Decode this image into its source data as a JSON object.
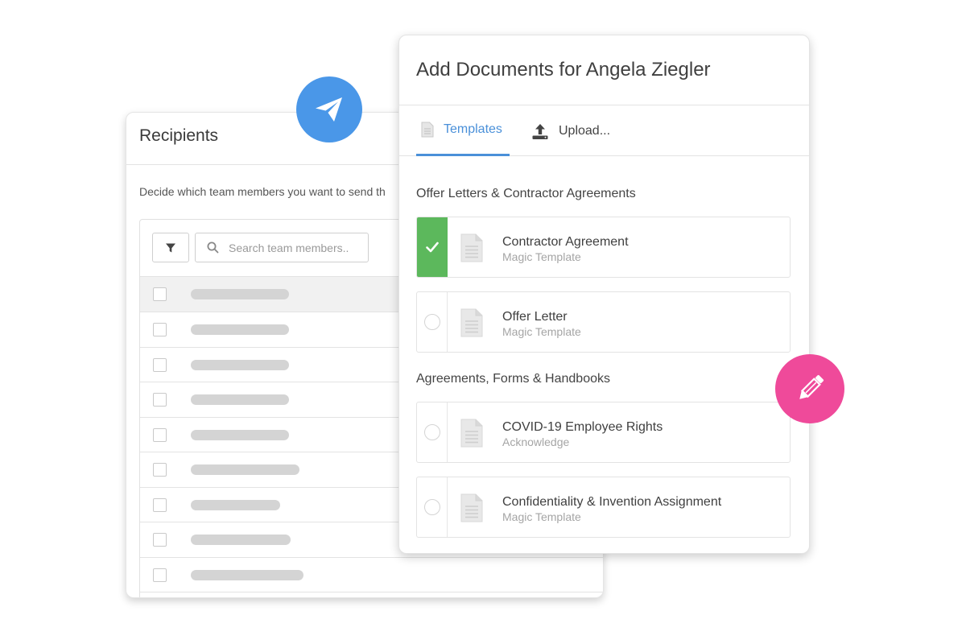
{
  "recipients": {
    "title": "Recipients",
    "description": "Decide which team members you want to send th",
    "search": {
      "placeholder": "Search team members.."
    },
    "rows": [
      {
        "bar": 0.55
      },
      {
        "bar": 0.55
      },
      {
        "bar": 0.55
      },
      {
        "bar": 0.55
      },
      {
        "bar": 0.61
      },
      {
        "bar": 0.5
      },
      {
        "bar": 0.56
      },
      {
        "bar": 0.63
      },
      {
        "bar": 0.51
      }
    ],
    "header_bar": 0.55
  },
  "documents": {
    "title": "Add Documents for Angela Ziegler",
    "tabs": [
      {
        "label": "Templates",
        "icon": "document-icon",
        "active": true
      },
      {
        "label": "Upload...",
        "icon": "upload-icon",
        "active": false
      }
    ],
    "sections": [
      {
        "title": "Offer Letters & Contractor Agreements",
        "items": [
          {
            "name": "Contractor Agreement",
            "subtitle": "Magic Template",
            "selected": true
          },
          {
            "name": "Offer Letter",
            "subtitle": "Magic Template",
            "selected": false
          }
        ]
      },
      {
        "title": "Agreements, Forms & Handbooks",
        "items": [
          {
            "name": "COVID-19 Employee Rights",
            "subtitle": "Acknowledge",
            "selected": false
          },
          {
            "name": "Confidentiality & Invention Assignment",
            "subtitle": "Magic Template",
            "selected": false
          }
        ]
      }
    ]
  },
  "colors": {
    "accent_blue": "#4a90d9",
    "send_bubble": "#4a97e8",
    "selected_green": "#5cb85c",
    "pencil_bubble": "#ef4a9a"
  },
  "icons": {
    "send": "paper-plane-icon",
    "edit": "pencil-icon",
    "filter": "filter-icon",
    "search": "search-icon"
  }
}
